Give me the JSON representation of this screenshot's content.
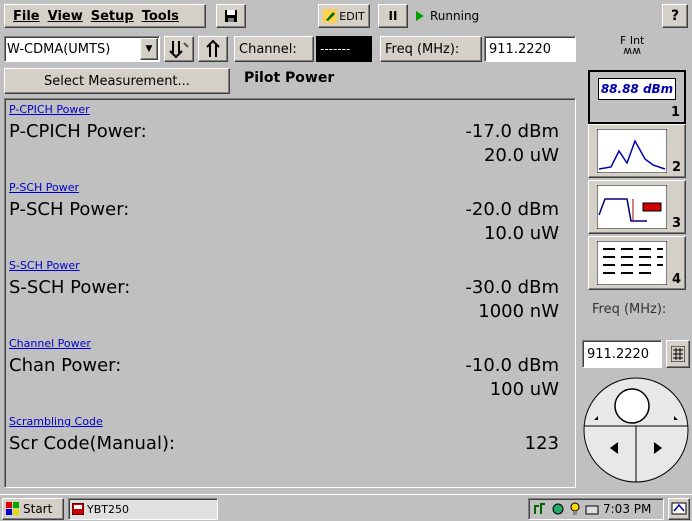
{
  "menu": {
    "file": "File",
    "view": "View",
    "setup": "Setup",
    "tools": "Tools"
  },
  "toolbar": {
    "edit_label": "EDIT",
    "pause_label": "II",
    "status": "Running",
    "help_label": "?",
    "mode": "W-CDMA(UMTS)",
    "channel_label": "Channel:",
    "channel_value": "-------",
    "freq_label": "Freq (MHz):",
    "freq_value": "911.2220",
    "fint_top": "F Int",
    "fint_bottom": "ʍʍ"
  },
  "measurement": {
    "select_button": "Select Measurement...",
    "title": "Pilot Power"
  },
  "sections": [
    {
      "link": "P-CPICH Power",
      "label": "P-CPICH Power:",
      "value1": "-17.0 dBm",
      "value2": "20.0 uW"
    },
    {
      "link": "P-SCH Power",
      "label": "P-SCH Power:",
      "value1": "-20.0 dBm",
      "value2": "10.0 uW"
    },
    {
      "link": "S-SCH Power",
      "label": "S-SCH Power:",
      "value1": "-30.0 dBm",
      "value2": "1000 nW"
    },
    {
      "link": "Channel Power",
      "label": "Chan Power:",
      "value1": "-10.0 dBm",
      "value2": "100 uW"
    },
    {
      "link": "Scrambling Code",
      "label": "Scr Code(Manual):",
      "value1": "123",
      "value2": ""
    }
  ],
  "side": {
    "readout": "88.88 dBm",
    "num1": "1",
    "num2": "2",
    "num3": "3",
    "num4": "4",
    "freq_label": "Freq (MHz):",
    "freq_value": "911.2220"
  },
  "taskbar": {
    "start": "Start",
    "app": "YBT250",
    "time": "7:03 PM"
  },
  "colors": {
    "link": "#0000cc",
    "readout_text": "#0000aa",
    "status_green": "#00a000"
  }
}
